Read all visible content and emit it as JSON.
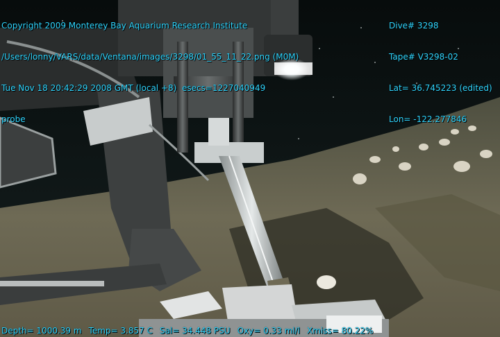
{
  "overlay": {
    "copyright": "Copyright 2009 Monterey Bay Aquarium Research Institute",
    "path": "/Users/lonny/VARS/data/Ventana/images/3298/01_55_11_22.png (M0M)",
    "datetime": "Tue Nov 18 20:42:29 2008 GMT (local +8)  esecs=1227040949",
    "annotation": "probe",
    "dive": "Dive# 3298",
    "tape": "Tape# V3298-02",
    "lat": "Lat= 36.745223 (edited)",
    "lon": "Lon= -122.277846",
    "depth": "Depth= 1000.39 m",
    "temp": "Temp= 3.857 C",
    "sal": "Sal= 34.448 PSU",
    "oxy": "Oxy= 0.33 ml/l",
    "xmiss": "Xmiss= 80.22%"
  },
  "colors": {
    "overlay_text": "#2fd6ff",
    "seafloor": "#6e6a55",
    "water": "#0e1515",
    "equipment": "#3a3c3c",
    "light": "#ffffff"
  },
  "scene": {
    "subject": "ROV sampling probe inserted into seafloor sediment",
    "icons": [
      "rov-arm",
      "probe-tube",
      "lamp",
      "sediment",
      "rocks"
    ]
  }
}
